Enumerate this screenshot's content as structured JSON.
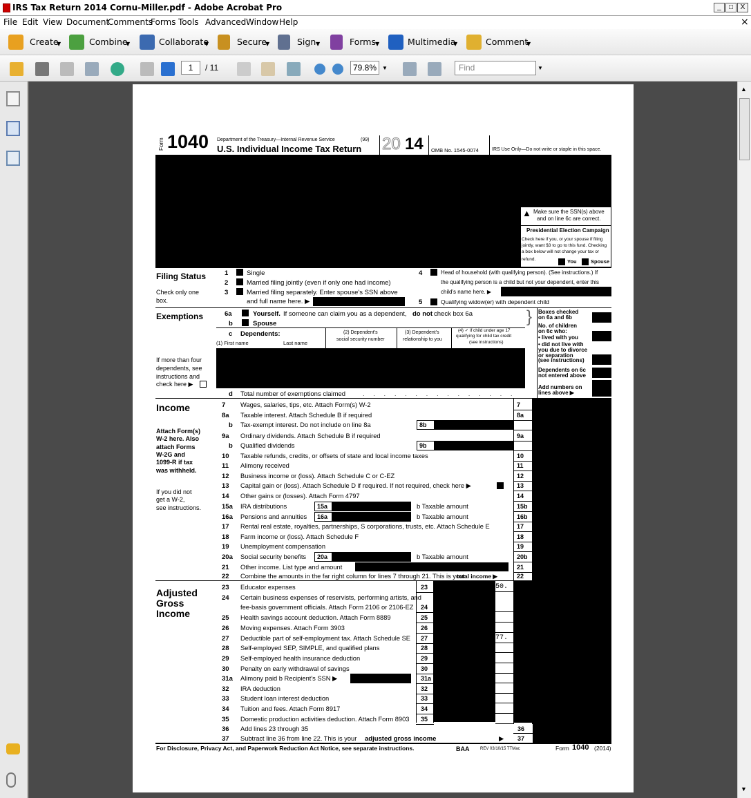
{
  "window": {
    "title": "IRS Tax Return 2014 Cornu-Miller.pdf - Adobe Acrobat Pro",
    "controls": [
      "_",
      "□",
      "X"
    ],
    "close_x": "×"
  },
  "menu": [
    "File",
    "Edit",
    "View",
    "Document",
    "Comments",
    "Forms",
    "Tools",
    "Advanced",
    "Window",
    "Help"
  ],
  "task_toolbar": [
    {
      "label": "Create",
      "icon": "create-icon",
      "color": "#e8a020"
    },
    {
      "label": "Combine",
      "icon": "combine-icon",
      "color": "#4ca040"
    },
    {
      "label": "Collaborate",
      "icon": "collaborate-icon",
      "color": "#3c6ab0"
    },
    {
      "label": "Secure",
      "icon": "lock-icon",
      "color": "#c89020"
    },
    {
      "label": "Sign",
      "icon": "pen-icon",
      "color": "#607090"
    },
    {
      "label": "Forms",
      "icon": "forms-icon",
      "color": "#8040a0"
    },
    {
      "label": "Multimedia",
      "icon": "multimedia-icon",
      "color": "#2060c0"
    },
    {
      "label": "Comment",
      "icon": "comment-icon",
      "color": "#e0b030"
    }
  ],
  "nav_toolbar": {
    "page_current": "1",
    "page_total": "/ 11",
    "zoom": "79.8%",
    "find_placeholder": "Find"
  },
  "form": {
    "form_label": "Form",
    "form_number": "1040",
    "dept": "Department of the Treasury—Internal Revenue Service",
    "code99": "(99)",
    "title": "U.S. Individual Income Tax Return",
    "year_outline": "20",
    "year_bold": "14",
    "omb": "OMB No. 1545-0074",
    "irs_use": "IRS Use Only—Do not write or staple in this space.",
    "ssn_note_1": "Make sure the SSN(s) above",
    "ssn_note_2": "and on line 6c are correct.",
    "pec_title": "Presidential Election Campaign",
    "pec_text": [
      "Check here if you, or your spouse if filing",
      "jointly, want $3 to go to this fund. Checking",
      "a box below will not change your tax or",
      "refund."
    ],
    "pec_you": "You",
    "pec_spouse": "Spouse",
    "filing_status": {
      "heading": "Filing Status",
      "sub": [
        "Check only one",
        "box."
      ],
      "l1": "Single",
      "l2": "Married filing jointly (even if only one had income)",
      "l3a": "Married filing separately. Enter spouse's SSN above",
      "l3b": "and full name here. ▶",
      "l4a": "Head of household (with qualifying person). (See instructions.) If",
      "l4b": "the qualifying person is a child but not your dependent, enter this",
      "l4c": "child's name here. ▶",
      "l5": "Qualifying widow(er) with dependent child"
    },
    "exemptions": {
      "heading": "Exemptions",
      "l6a_b": "Yourself.",
      "l6a_t": "If someone can claim you as a dependent,",
      "l6a_nb": "do not",
      "l6a_t2": "check box 6a",
      "l6b": "Spouse",
      "l6c": "Dependents:",
      "first": "(1) First name",
      "last": "Last name",
      "col2": [
        "(2) Dependent's",
        "social security number"
      ],
      "col3": [
        "(3) Dependent's",
        "relationship to you"
      ],
      "col4": [
        "(4) ✓ if child under age 17",
        "qualifying for child tax credit",
        "(see instructions)"
      ],
      "more": [
        "If more than four",
        "dependents, see",
        "instructions and",
        "check here ▶"
      ],
      "l6d": "Total number of exemptions claimed",
      "right": [
        "Boxes checked",
        "on 6a and 6b",
        "No. of children",
        "on 6c who:",
        "• lived with you",
        "• did not live with",
        "you due to divorce",
        "or separation",
        "(see instructions)",
        "Dependents on 6c",
        "not entered above",
        "Add numbers on",
        "lines above ▶"
      ]
    },
    "income": {
      "heading": "Income",
      "attach": [
        "Attach Form(s)",
        "W-2 here. Also",
        "attach Forms",
        "W-2G and",
        "1099-R if tax",
        "was withheld."
      ],
      "nw2": [
        "If you did not",
        "get a W-2,",
        "see instructions."
      ],
      "lines": [
        {
          "n": "7",
          "t": "Wages, salaries, tips, etc. Attach Form(s) W-2"
        },
        {
          "n": "8a",
          "t": "Taxable interest. Attach Schedule B if required"
        },
        {
          "n": "b",
          "t": "Tax-exempt interest. Do not include on line 8a",
          "mid": "8b"
        },
        {
          "n": "9a",
          "t": "Ordinary dividends. Attach Schedule B if required"
        },
        {
          "n": "b",
          "t": "Qualified dividends",
          "mid": "9b"
        },
        {
          "n": "10",
          "t": "Taxable refunds, credits, or offsets of state and local income taxes"
        },
        {
          "n": "11",
          "t": "Alimony received"
        },
        {
          "n": "12",
          "t": "Business income or (loss). Attach Schedule C or C-EZ"
        },
        {
          "n": "13",
          "t": "Capital gain or (loss). Attach Schedule D if required. If not required, check here ▶"
        },
        {
          "n": "14",
          "t": "Other gains or (losses). Attach Form 4797"
        },
        {
          "n": "15a",
          "t": "IRA distributions",
          "mid": "15a",
          "bt": "b  Taxable amount",
          "right": "15b"
        },
        {
          "n": "16a",
          "t": "Pensions and annuities",
          "mid": "16a",
          "bt": "b  Taxable amount",
          "right": "16b"
        },
        {
          "n": "17",
          "t": "Rental real estate, royalties, partnerships, S corporations, trusts, etc. Attach Schedule E"
        },
        {
          "n": "18",
          "t": "Farm income or (loss). Attach Schedule F"
        },
        {
          "n": "19",
          "t": "Unemployment compensation"
        },
        {
          "n": "20a",
          "t": "Social security benefits",
          "mid": "20a",
          "bt": "b  Taxable amount",
          "right": "20b"
        },
        {
          "n": "21",
          "t": "Other income. List type and amount"
        },
        {
          "n": "22",
          "t": "Combine the amounts in the far right column for lines 7 through 21. This is your",
          "tb": "total income ▶"
        }
      ]
    },
    "agi": {
      "heading": [
        "Adjusted",
        "Gross",
        "Income"
      ],
      "lines": [
        {
          "n": "23",
          "t": "Educator expenses",
          "val": "50."
        },
        {
          "n": "24",
          "t": "Certain business expenses of reservists, performing artists, and",
          "t2": "fee-basis government officials. Attach Form 2106 or 2106-EZ"
        },
        {
          "n": "25",
          "t": "Health savings account deduction. Attach Form 8889"
        },
        {
          "n": "26",
          "t": "Moving expenses. Attach Form 3903"
        },
        {
          "n": "27",
          "t": "Deductible part of self-employment tax. Attach Schedule SE",
          "val": "77."
        },
        {
          "n": "28",
          "t": "Self-employed SEP, SIMPLE, and qualified plans"
        },
        {
          "n": "29",
          "t": "Self-employed health insurance deduction"
        },
        {
          "n": "30",
          "t": "Penalty on early withdrawal of savings"
        },
        {
          "n": "31a",
          "t": "Alimony paid  b Recipient's SSN ▶"
        },
        {
          "n": "32",
          "t": "IRA deduction"
        },
        {
          "n": "33",
          "t": "Student loan interest deduction"
        },
        {
          "n": "34",
          "t": "Tuition and fees. Attach Form 8917"
        },
        {
          "n": "35",
          "t": "Domestic production activities deduction. Attach Form 8903"
        },
        {
          "n": "36",
          "t": "Add lines 23 through 35"
        },
        {
          "n": "37",
          "t": "Subtract line 36 from line 22. This is your",
          "tb": "adjusted gross income"
        }
      ]
    },
    "footer": {
      "left": "For Disclosure, Privacy Act, and Paperwork Reduction Act Notice, see separate instructions.",
      "baa": "BAA",
      "rev": "REV 03/10/15 TTMac",
      "form": "Form",
      "num": "1040",
      "yr": "(2014)"
    }
  }
}
